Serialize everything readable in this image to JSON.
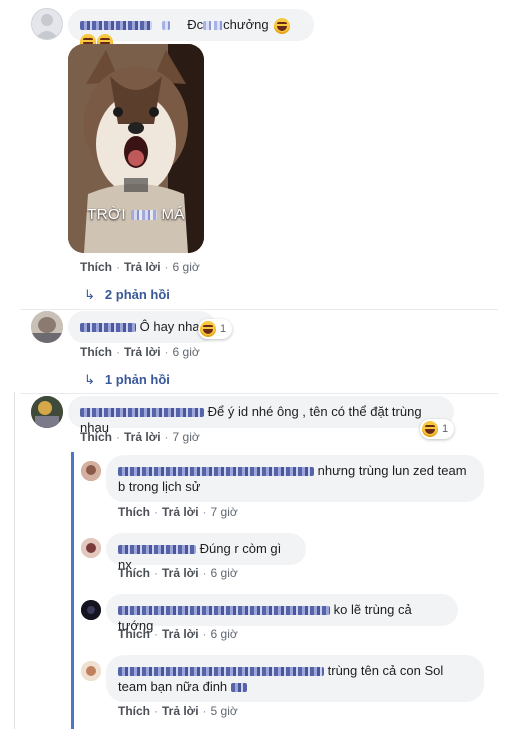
{
  "comments": [
    {
      "author_label": "",
      "text_a": "Đc",
      "text_b": "chưởng",
      "image_caption_a": "TRỜI",
      "image_caption_b": "MÁ",
      "actions": {
        "like": "Thích",
        "reply": "Trả lời",
        "time": "6 giờ"
      },
      "replies_label": "2 phản hồi"
    },
    {
      "text": "Ô hay nha",
      "reaction_count": "1",
      "actions": {
        "like": "Thích",
        "reply": "Trả lời",
        "time": "6 giờ"
      },
      "replies_label": "1 phản hồi"
    },
    {
      "text": "Để ý id nhé ông , tên có thể đặt trùng nhau",
      "reaction_count": "1",
      "actions": {
        "like": "Thích",
        "reply": "Trả lời",
        "time": "7 giờ"
      }
    }
  ],
  "replies": [
    {
      "text_line1": "nhưng trùng lun zed team",
      "text_line2": "b trong lịch sử",
      "actions": {
        "like": "Thích",
        "reply": "Trả lời",
        "time": "7 giờ"
      }
    },
    {
      "text": "Đúng r còm gì nx",
      "actions": {
        "like": "Thích",
        "reply": "Trả lời",
        "time": "6 giờ"
      }
    },
    {
      "text": "ko lẽ trùng cả tướng",
      "actions": {
        "like": "Thích",
        "reply": "Trả lời",
        "time": "6 giờ"
      }
    },
    {
      "text_line1": "trùng tên cả con Sol",
      "text_line2": "team bạn nữa đinh",
      "actions": {
        "like": "Thích",
        "reply": "Trả lời",
        "time": "5 giờ"
      }
    }
  ],
  "icons": {
    "reply_arrow": "↳",
    "haha_emoji": "haha-emoji-icon"
  }
}
